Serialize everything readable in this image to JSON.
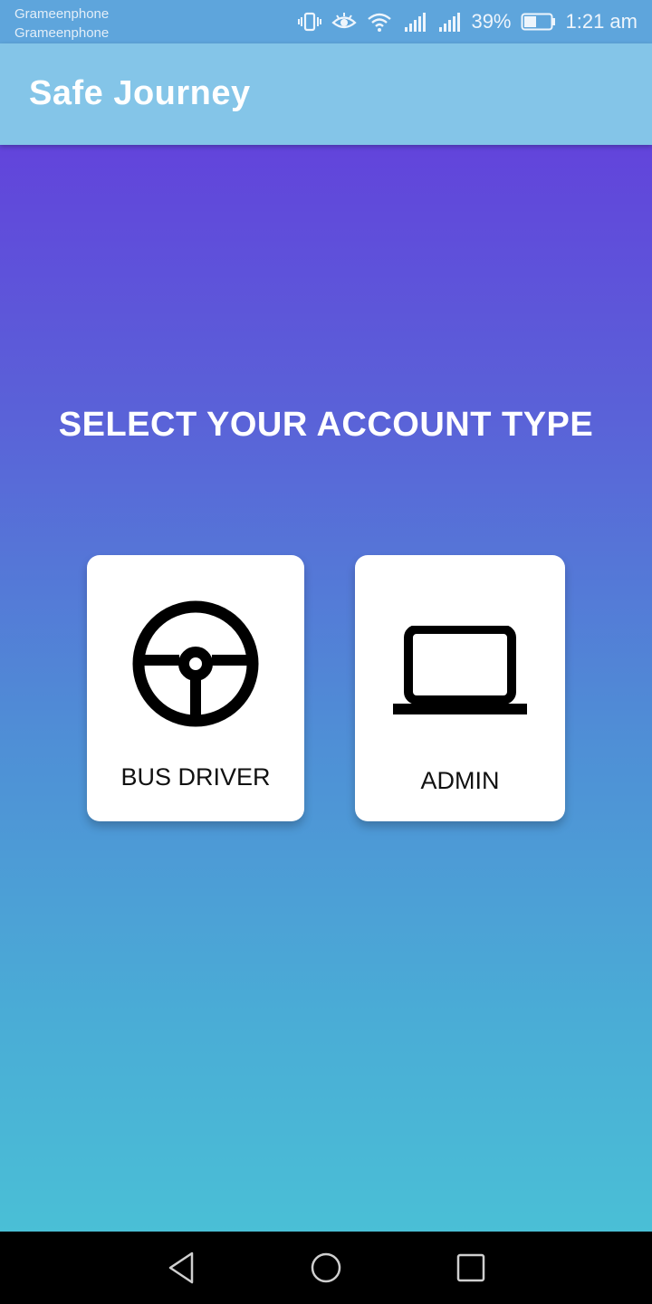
{
  "status_bar": {
    "carrier_1": "Grameenphone",
    "carrier_2": "Grameenphone",
    "battery_percent": "39%",
    "time": "1:21 am",
    "icons": [
      "vibrate-icon",
      "eye-comfort-icon",
      "wifi-icon",
      "signal-1-icon",
      "signal-2-icon",
      "battery-icon"
    ]
  },
  "app_bar": {
    "title": "Safe Journey"
  },
  "main": {
    "prompt": "SELECT YOUR ACCOUNT TYPE",
    "options": [
      {
        "label": "BUS DRIVER",
        "icon": "steering-wheel-icon"
      },
      {
        "label": "ADMIN",
        "icon": "laptop-icon"
      }
    ]
  },
  "nav_bar": {
    "buttons": [
      "back-icon",
      "home-icon",
      "recents-icon"
    ]
  },
  "colors": {
    "status_bar": "#5ea5dc",
    "app_bar": "#84c5e8",
    "gradient_top": "#6244db",
    "gradient_bottom": "#4abfd6",
    "card": "#ffffff"
  }
}
